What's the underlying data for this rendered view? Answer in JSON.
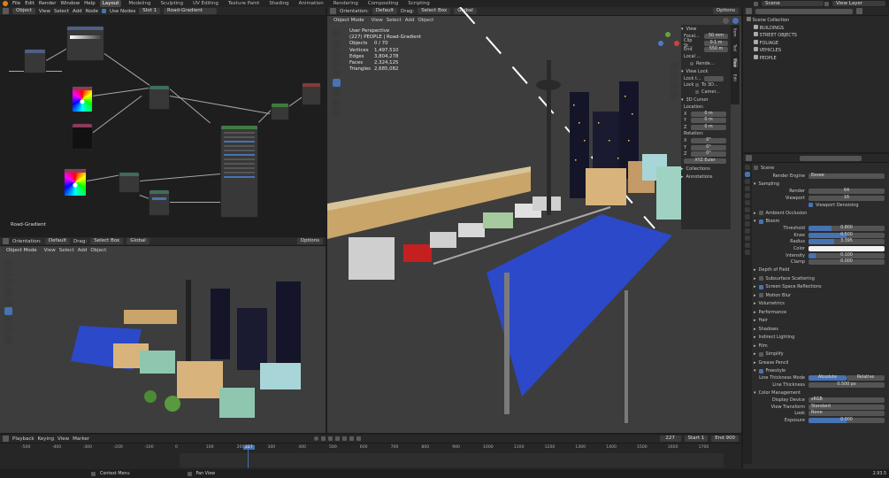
{
  "topbar": {
    "menus": [
      "File",
      "Edit",
      "Render",
      "Window",
      "Help"
    ],
    "workspaces": [
      "Layout",
      "Modeling",
      "Sculpting",
      "UV Editing",
      "Texture Paint",
      "Shading",
      "Animation",
      "Rendering",
      "Compositing",
      "Scripting"
    ],
    "active": "Layout",
    "scene": "Scene",
    "view_layer": "View Layer"
  },
  "node_editor": {
    "mode": "Object",
    "menus": [
      "View",
      "Select",
      "Add",
      "Node"
    ],
    "use_nodes": "Use Nodes",
    "slot": "Slot 1",
    "material": "Road-Gradient",
    "label": "Road-Gradient"
  },
  "viewport_small": {
    "mode": "Object Mode",
    "menus": [
      "View",
      "Select",
      "Add",
      "Object"
    ],
    "orientation": "Orientation:",
    "orient_val": "Default",
    "drag": "Drag:",
    "drag_val": "Select Box",
    "transform": "Global",
    "options": "Options"
  },
  "viewport_main": {
    "mode": "Object Mode",
    "menus": [
      "View",
      "Select",
      "Add",
      "Object"
    ],
    "orientation": "Orientation:",
    "orient_val": "Default",
    "drag": "Drag:",
    "drag_val": "Select Box",
    "transform": "Global",
    "options": "Options",
    "overlay_title": "User Perspective",
    "overlay_sub": "(227) PEOPLE | Road-Gradient",
    "stats": [
      [
        "Objects",
        "0 / 70"
      ],
      [
        "Vertices",
        "1,497,510"
      ],
      [
        "Edges",
        "3,804,278"
      ],
      [
        "Faces",
        "2,324,125"
      ],
      [
        "Triangles",
        "2,685,082"
      ]
    ]
  },
  "npanel": {
    "view_header": "View",
    "focal": "Focal...",
    "focal_v": "50 mm",
    "clip_s": "Clip St...",
    "clip_s_v": "0.1 m",
    "end": "End",
    "end_v": "550 m",
    "local": "Local ...",
    "render": "Rende...",
    "view_lock": "View Lock",
    "lock_to": "Lock t...",
    "lock": "Lock",
    "to3d": "To 3D...",
    "camera": "Camer...",
    "cursor": "3D Cursor",
    "location": "Location:",
    "loc": [
      [
        "X",
        "0 m"
      ],
      [
        "Y",
        "0 m"
      ],
      [
        "Z",
        "0 m"
      ]
    ],
    "rotation": "Rotation:",
    "rot": [
      [
        "X",
        "0°"
      ],
      [
        "Y",
        "0°"
      ],
      [
        "Z",
        "0°"
      ]
    ],
    "euler": "XYZ Euler",
    "collections": "Collections",
    "annotations": "Annotations",
    "tabs": [
      "Item",
      "Tool",
      "View",
      "Edit"
    ]
  },
  "outliner": {
    "root": "Scene Collection",
    "items": [
      "BUILDINGS",
      "STREET OBJECTS",
      "FOLIAGE",
      "VEHICLES",
      "PEOPLE"
    ]
  },
  "properties": {
    "scene": "Scene",
    "render_engine": "Render Engine",
    "engine_v": "Eevee",
    "sampling": "Sampling",
    "render": "Render",
    "render_v": "64",
    "viewport": "Viewport",
    "viewport_v": "16",
    "denoise": "Viewport Denoising",
    "ao": "Ambient Occlusion",
    "bloom": "Bloom",
    "bloom_rows": [
      [
        "Threshold",
        "0.800"
      ],
      [
        "Knee",
        "0.500"
      ],
      [
        "Radius",
        "3.395"
      ],
      [
        "Color",
        ""
      ],
      [
        "Intensity",
        "0.100"
      ],
      [
        "Clamp",
        "0.000"
      ]
    ],
    "sections": [
      "Depth of Field",
      "Subsurface Scattering",
      "Screen Space Reflections",
      "Motion Blur",
      "Volumetrics",
      "Performance",
      "Hair",
      "Shadows",
      "Indirect Lighting",
      "Film",
      "Simplify",
      "Grease Pencil",
      "Freestyle"
    ],
    "line_mode": "Line Thickness Mode",
    "absolute": "Absolute",
    "relative": "Relative",
    "line_thick": "Line Thickness",
    "line_thick_v": "0.500 px",
    "color_mgmt": "Color Management",
    "display": "Display Device",
    "display_v": "sRGB",
    "view_t": "View Transform",
    "view_t_v": "Standard",
    "look": "Look",
    "look_v": "None",
    "exposure": "Exposure",
    "exposure_v": "0.000"
  },
  "timeline": {
    "menus": [
      "Playback",
      "Keying",
      "View",
      "Marker"
    ],
    "current": "227",
    "start_lbl": "Start",
    "start": "1",
    "end_lbl": "End",
    "end": "900",
    "ticks": [
      "-500",
      "-400",
      "-300",
      "-200",
      "-100",
      "0",
      "100",
      "200",
      "300",
      "400",
      "500",
      "600",
      "700",
      "800",
      "900",
      "1000",
      "1100",
      "1200",
      "1300",
      "1400",
      "1500",
      "1600",
      "1700"
    ]
  },
  "status": {
    "left": "Context Menu",
    "right": "Pan View",
    "version": "2.93.5"
  },
  "colors": {
    "accent": "#4772b3",
    "road": "#2c49c9",
    "header": "#303030",
    "bg": "#3d3d3d"
  }
}
